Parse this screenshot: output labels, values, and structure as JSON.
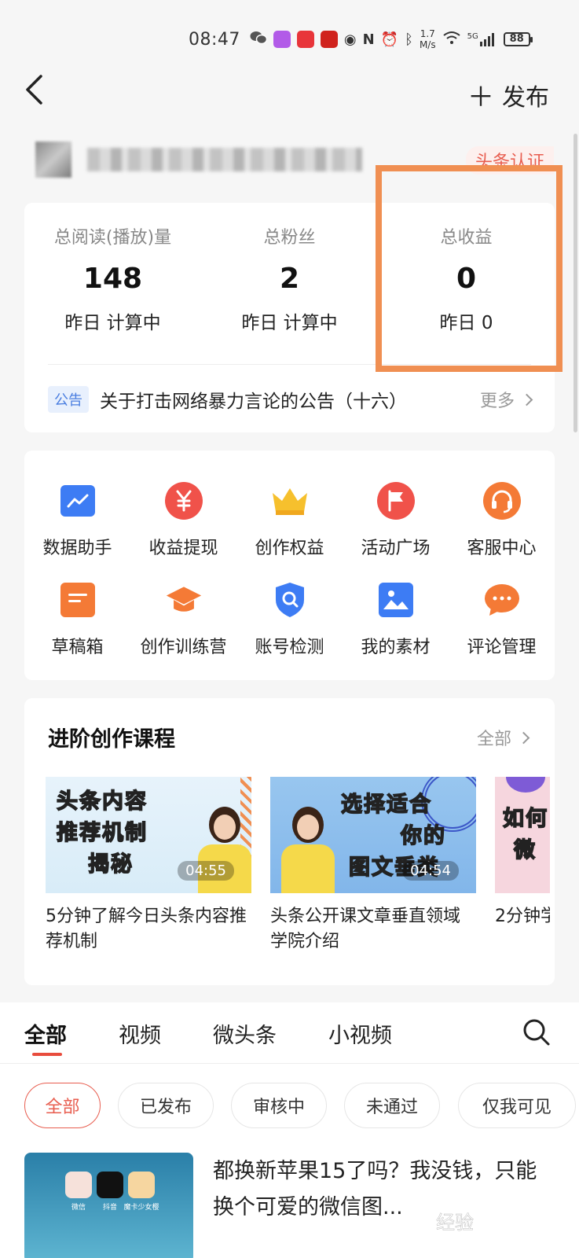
{
  "status_bar": {
    "time": "08:47",
    "speed_value": "1.7",
    "speed_unit": "M/s",
    "network": "5G",
    "battery": "88"
  },
  "nav": {
    "publish_label": "发布"
  },
  "user": {
    "cert_tag": "头条认证"
  },
  "stats": [
    {
      "label": "总阅读(播放)量",
      "value": "148",
      "sub": "昨日 计算中"
    },
    {
      "label": "总粉丝",
      "value": "2",
      "sub": "昨日 计算中"
    },
    {
      "label": "总收益",
      "value": "0",
      "sub": "昨日 0"
    }
  ],
  "notice": {
    "tag": "公告",
    "text": "关于打击网络暴力言论的公告（十六）",
    "more": "更多"
  },
  "tools": [
    {
      "label": "数据助手",
      "icon": "chart-icon",
      "color": "#3d7cf4"
    },
    {
      "label": "收益提现",
      "icon": "yuan-icon",
      "color": "#f0524a"
    },
    {
      "label": "创作权益",
      "icon": "crown-icon",
      "color": "#f6c02d"
    },
    {
      "label": "活动广场",
      "icon": "flag-icon",
      "color": "#f0524a"
    },
    {
      "label": "客服中心",
      "icon": "headset-icon",
      "color": "#f47a36"
    },
    {
      "label": "草稿箱",
      "icon": "draft-icon",
      "color": "#f47a36"
    },
    {
      "label": "创作训练营",
      "icon": "graduation-cap-icon",
      "color": "#f47a36"
    },
    {
      "label": "账号检测",
      "icon": "shield-search-icon",
      "color": "#3d7cf4"
    },
    {
      "label": "我的素材",
      "icon": "image-icon",
      "color": "#3d7cf4"
    },
    {
      "label": "评论管理",
      "icon": "comment-icon",
      "color": "#f47a36"
    }
  ],
  "courses": {
    "title": "进阶创作课程",
    "all": "全部",
    "items": [
      {
        "thumb_text_1": "头条内容",
        "thumb_text_2": "推荐机制",
        "thumb_text_3": "揭秘",
        "duration": "04:55",
        "caption": "5分钟了解今日头条内容推荐机制"
      },
      {
        "thumb_text_1": "选择适合",
        "thumb_text_2": "你的",
        "thumb_text_3": "图文垂类",
        "duration": "04:54",
        "caption": "头条公开课文章垂直领域学院介绍"
      },
      {
        "thumb_text_1": "如何",
        "thumb_text_2": "微",
        "thumb_text_3": "",
        "duration": "",
        "caption": "2分钟学"
      }
    ]
  },
  "tabs": [
    "全部",
    "视频",
    "微头条",
    "小视频"
  ],
  "filters": [
    "全部",
    "已发布",
    "审核中",
    "未通过",
    "仅我可见"
  ],
  "article": {
    "title": "都换新苹果15了吗？我没钱，只能换个可爱的微信图...",
    "apps": [
      "微信",
      "抖音",
      "魔卡少女樱"
    ]
  },
  "watermark": "经验"
}
